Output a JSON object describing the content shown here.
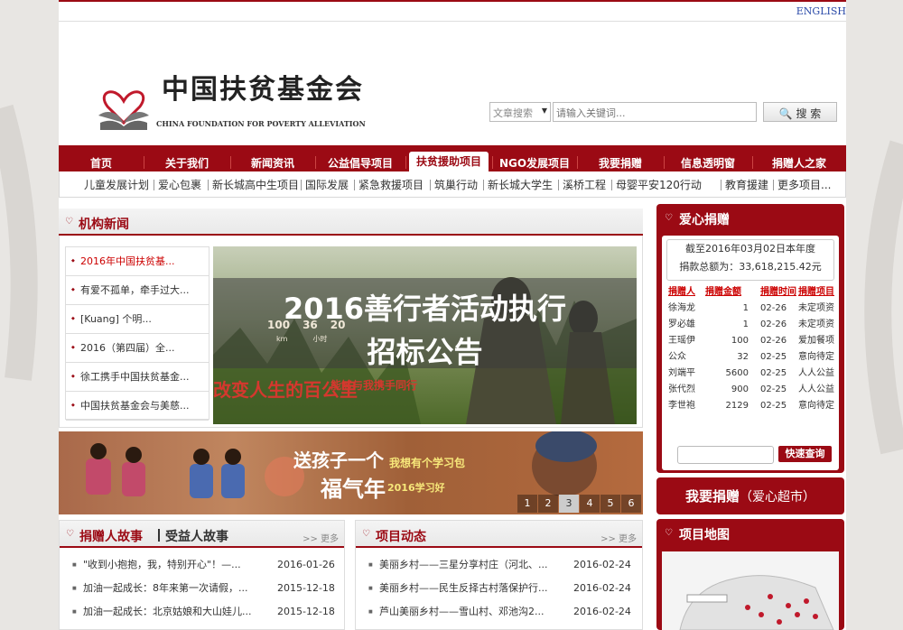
{
  "top": {
    "english": "ENGLISH"
  },
  "brand": {
    "cn": "中国扶贫基金会",
    "en": "CHINA FOUNDATION FOR POVERTY ALLEVIATION"
  },
  "search": {
    "scope": "文章搜索",
    "placeholder": "请输入关键词...",
    "button": "搜 索"
  },
  "nav": [
    "首页",
    "关于我们",
    "新闻资讯",
    "公益倡导项目",
    "扶贫援助项目",
    "NGO发展项目",
    "我要捐赠",
    "信息透明窗",
    "捐赠人之家"
  ],
  "nav_active": "扶贫援助项目",
  "subnav": [
    "儿童发展计划",
    "爱心包裹",
    "新长城高中生项目",
    "国际发展",
    "紧急救援项目",
    "筑巢行动",
    "新长城大学生",
    "溪桥工程",
    "母婴平安120行动",
    "教育援建",
    "更多项目..."
  ],
  "news": {
    "title": "机构新闻",
    "items": [
      "2016年中国扶贫基...",
      "有爱不孤单，牵手过大...",
      "[Kuang] 个明...",
      "2016（第四届）全...",
      "徐工携手中国扶贫基金...",
      "中国扶贫基金会与美慈..."
    ]
  },
  "slide": {
    "headline1": "2016善行者活动执行",
    "headline2": "招标公告",
    "caption": "改变人生的百公里",
    "caption2": "能够与我携手同行",
    "stat1": "100",
    "stat2": "36",
    "stat3": "20",
    "unit1": "km",
    "unit2": "小时"
  },
  "banner": {
    "text1": "送孩子一个",
    "text2": "福气年",
    "text3": "我想有个学习包",
    "text4": "2016学习好",
    "pages": [
      "1",
      "2",
      "3",
      "4",
      "5",
      "6"
    ],
    "active_page": "3"
  },
  "donate": {
    "title": "爱心捐赠",
    "date_line": "截至2016年03月02日本年度",
    "total_line": "捐款总额为：33,618,215.42元",
    "headers": [
      "捐赠人",
      "捐赠金额",
      "捐赠时间",
      "捐赠项目"
    ],
    "rows": [
      [
        "徐海龙",
        "1",
        "02-26",
        "未定项资"
      ],
      [
        "罗必雄",
        "1",
        "02-26",
        "未定项资"
      ],
      [
        "王瑶伊",
        "100",
        "02-26",
        "爱加餐项"
      ],
      [
        "公众",
        "32",
        "02-25",
        "意向待定"
      ],
      [
        "刘端平",
        "5600",
        "02-25",
        "人人公益"
      ],
      [
        "张代烈",
        "900",
        "02-25",
        "人人公益"
      ],
      [
        "李世袍",
        "2129",
        "02-25",
        "意向待定"
      ]
    ],
    "query_button": "快速查询"
  },
  "donate_cta": {
    "main": "我要捐赠",
    "sub": "（爱心超市）"
  },
  "project_map": {
    "title": "项目地图"
  },
  "stories": {
    "title": "捐赠人故事",
    "title2": "受益人故事",
    "more": ">> 更多",
    "items": [
      {
        "text": "\"收到小抱抱，我，特别开心\"！—...",
        "date": "2016-01-26"
      },
      {
        "text": "加油一起成长：8年来第一次请假，...",
        "date": "2015-12-18"
      },
      {
        "text": "加油一起成长：北京姑娘和大山娃儿...",
        "date": "2015-12-18"
      }
    ]
  },
  "projects": {
    "title": "项目动态",
    "more": ">> 更多",
    "items": [
      {
        "text": "美丽乡村——三星分享村庄（河北、...",
        "date": "2016-02-24"
      },
      {
        "text": "美丽乡村——民生反择古村落保护行...",
        "date": "2016-02-24"
      },
      {
        "text": "芦山美丽乡村——雪山村、邓池沟2...",
        "date": "2016-02-24"
      }
    ]
  },
  "colors": {
    "brand_red": "#9b0a14",
    "link_blue": "#2a4aa8"
  }
}
